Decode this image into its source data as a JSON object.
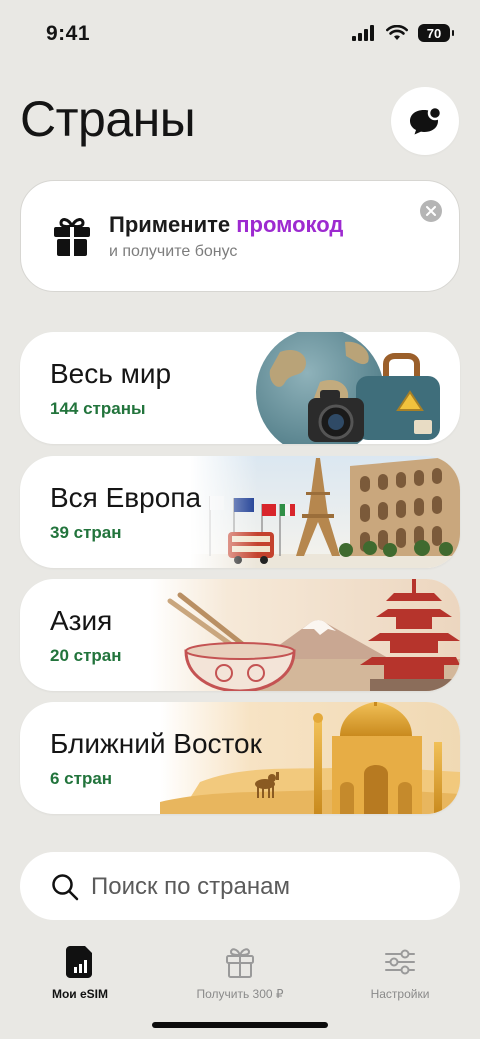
{
  "status": {
    "time": "9:41",
    "battery": "70"
  },
  "header": {
    "title": "Страны"
  },
  "promo": {
    "title_prefix": "Примените ",
    "title_accent": "промокод",
    "subtitle": "и получите бонус"
  },
  "regions": [
    {
      "name": "Весь мир",
      "count": "144 страны"
    },
    {
      "name": "Вся Европа",
      "count": "39 стран"
    },
    {
      "name": "Азия",
      "count": "20 стран"
    },
    {
      "name": "Ближний Восток",
      "count": "6 стран"
    }
  ],
  "search": {
    "placeholder": "Поиск по странам"
  },
  "tabs": [
    {
      "label": "Мои eSIM",
      "active": true
    },
    {
      "label": "Получить 300 ₽",
      "active": false
    },
    {
      "label": "Настройки",
      "active": false
    }
  ],
  "colors": {
    "accent": "#9d2ad0",
    "count_green": "#22743c",
    "background": "#e9e8e4"
  }
}
